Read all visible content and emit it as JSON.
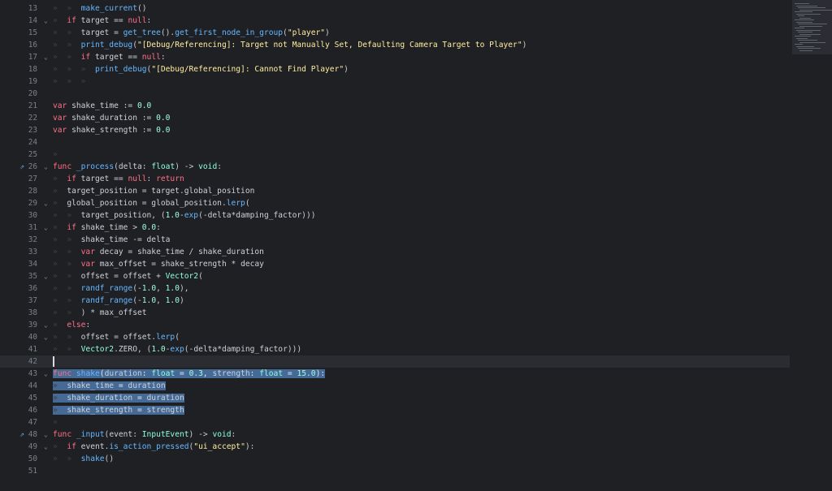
{
  "editor": {
    "lines": [
      {
        "n": "13",
        "ind": 2,
        "code": "make_current()"
      },
      {
        "n": "14",
        "ind": 1,
        "fold": "˅",
        "code": "if target == null:"
      },
      {
        "n": "15",
        "ind": 2,
        "code": "target = get_tree().get_first_node_in_group(\"player\")"
      },
      {
        "n": "16",
        "ind": 2,
        "code": "print_debug(\"[Debug/Referencing]: Target not Manually Set, Defaulting Camera Target to Player\")"
      },
      {
        "n": "17",
        "ind": 2,
        "fold": "˅",
        "code": "if target == null:"
      },
      {
        "n": "18",
        "ind": 3,
        "code": "print_debug(\"[Debug/Referencing]: Cannot Find Player\")"
      },
      {
        "n": "19",
        "ind": 3,
        "code": ""
      },
      {
        "n": "20",
        "ind": 0,
        "code": ""
      },
      {
        "n": "21",
        "ind": 0,
        "code": "var shake_time := 0.0"
      },
      {
        "n": "22",
        "ind": 0,
        "code": "var shake_duration := 0.0"
      },
      {
        "n": "23",
        "ind": 0,
        "code": "var shake_strength := 0.0"
      },
      {
        "n": "24",
        "ind": 0,
        "code": ""
      },
      {
        "n": "25",
        "ind": 1,
        "code": ""
      },
      {
        "n": "26",
        "ind": 0,
        "icon": "override",
        "fold": "˅",
        "code": "func _process(delta: float) -> void:"
      },
      {
        "n": "27",
        "ind": 1,
        "code": "if target == null: return"
      },
      {
        "n": "28",
        "ind": 1,
        "code": "target_position = target.global_position"
      },
      {
        "n": "29",
        "ind": 1,
        "fold": "˅",
        "code": "global_position = global_position.lerp("
      },
      {
        "n": "30",
        "ind": 2,
        "code": "target_position, (1.0-exp(-delta*damping_factor)))"
      },
      {
        "n": "31",
        "ind": 1,
        "fold": "˅",
        "code": "if shake_time > 0.0:"
      },
      {
        "n": "32",
        "ind": 2,
        "code": "shake_time -= delta"
      },
      {
        "n": "33",
        "ind": 2,
        "code": "var decay = shake_time / shake_duration"
      },
      {
        "n": "34",
        "ind": 2,
        "code": "var max_offset = shake_strength * decay"
      },
      {
        "n": "35",
        "ind": 2,
        "fold": "˅",
        "code": "offset = offset + Vector2("
      },
      {
        "n": "36",
        "ind": 2,
        "code": "randf_range(-1.0, 1.0),"
      },
      {
        "n": "37",
        "ind": 2,
        "code": "randf_range(-1.0, 1.0)"
      },
      {
        "n": "38",
        "ind": 2,
        "code": ") * max_offset"
      },
      {
        "n": "39",
        "ind": 1,
        "fold": "˅",
        "code": "else:"
      },
      {
        "n": "40",
        "ind": 2,
        "fold": "˅",
        "code": "offset = offset.lerp("
      },
      {
        "n": "41",
        "ind": 2,
        "code": "Vector2.ZERO, (1.0-exp(-delta*damping_factor)))"
      },
      {
        "n": "42",
        "ind": 0,
        "code": "",
        "current": true,
        "caret": true
      },
      {
        "n": "43",
        "ind": 0,
        "fold": "˅",
        "code": "func shake(duration: float = 0.3, strength: float = 15.0):",
        "selected": true
      },
      {
        "n": "44",
        "ind": 1,
        "code": "shake_time = duration",
        "selected": true
      },
      {
        "n": "45",
        "ind": 1,
        "code": "shake_duration = duration",
        "selected": true
      },
      {
        "n": "46",
        "ind": 1,
        "code": "shake_strength = strength",
        "selected": true
      },
      {
        "n": "47",
        "ind": 1,
        "code": ""
      },
      {
        "n": "48",
        "ind": 0,
        "icon": "override",
        "fold": "˅",
        "code": "func _input(event: InputEvent) -> void:"
      },
      {
        "n": "49",
        "ind": 1,
        "fold": "˅",
        "code": "if event.is_action_pressed(\"ui_accept\"):"
      },
      {
        "n": "50",
        "ind": 2,
        "code": "shake()"
      },
      {
        "n": "51",
        "ind": 0,
        "code": ""
      }
    ]
  },
  "colors": {
    "background": "#1f2024",
    "selection": "#456a96",
    "keyword": "#ff7085",
    "function": "#66b7ff",
    "string": "#ffeda1",
    "number": "#a1ffe0"
  },
  "icons": {
    "override": "override-arrow-icon",
    "fold": "chevron-down-icon"
  }
}
